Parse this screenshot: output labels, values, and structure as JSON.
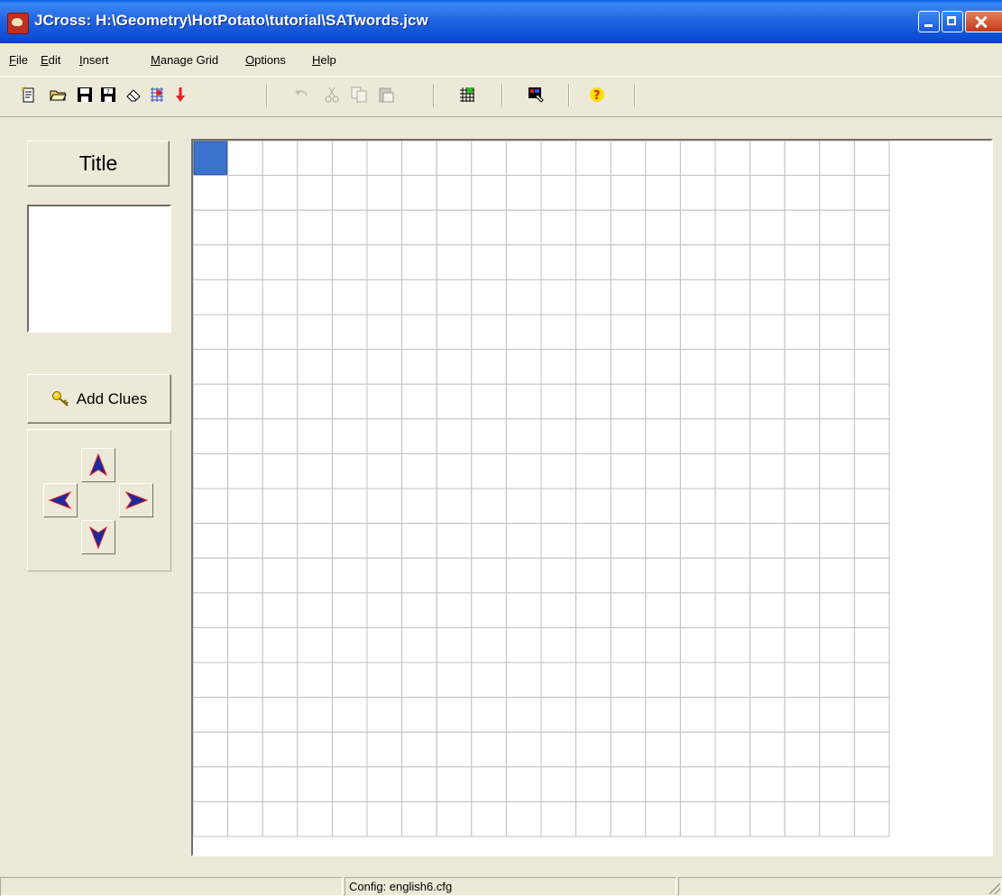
{
  "window": {
    "title": "JCross: H:\\Geometry\\HotPotato\\tutorial\\SATwords.jcw"
  },
  "menu": [
    "File",
    "Edit",
    "Insert",
    "Manage Grid",
    "Options",
    "Help"
  ],
  "toolbar": [
    {
      "icon": "new-file-icon",
      "enabled": true
    },
    {
      "icon": "open-folder-icon",
      "enabled": true
    },
    {
      "icon": "save-icon",
      "enabled": true
    },
    {
      "icon": "save-as-icon",
      "enabled": true
    },
    {
      "icon": "erase-icon",
      "enabled": true
    },
    {
      "icon": "web-export-icon",
      "enabled": true
    },
    {
      "icon": "down-arrow-icon",
      "enabled": true
    },
    {
      "icon": "undo-icon",
      "enabled": false
    },
    {
      "icon": "cut-icon",
      "enabled": false
    },
    {
      "icon": "copy-icon",
      "enabled": false
    },
    {
      "icon": "paste-icon",
      "enabled": false
    },
    {
      "icon": "grid-icon",
      "enabled": true
    },
    {
      "icon": "config-icon",
      "enabled": true
    },
    {
      "icon": "help-icon",
      "enabled": true
    }
  ],
  "left_panel": {
    "title_button": "Title",
    "title_text": "",
    "add_clues_button": "Add Clues"
  },
  "grid": {
    "columns": 20,
    "rows": 20,
    "selected_cell": {
      "row": 0,
      "col": 0
    },
    "colors": {
      "line": "#c0c0c0",
      "selected": "#3c72cf"
    }
  },
  "status": {
    "panel1": "",
    "config": "Config: english6.cfg",
    "panel3": ""
  }
}
